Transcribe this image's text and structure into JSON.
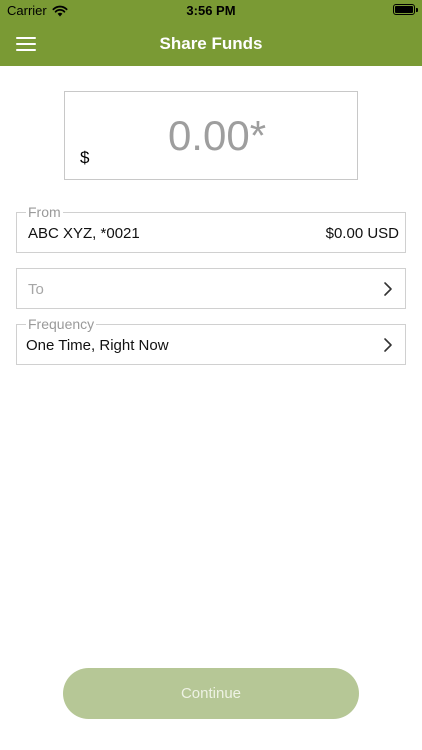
{
  "status_bar": {
    "carrier": "Carrier",
    "time": "3:56 PM"
  },
  "nav": {
    "title": "Share Funds",
    "menu_icon": "hamburger-menu-icon"
  },
  "amount": {
    "currency_symbol": "$",
    "value": "0.00*"
  },
  "from": {
    "label": "From",
    "account": "ABC XYZ, *0021",
    "balance": "$0.00 USD"
  },
  "to": {
    "placeholder": "To"
  },
  "frequency": {
    "label": "Frequency",
    "value": "One Time, Right Now"
  },
  "continue_button": {
    "label": "Continue"
  },
  "colors": {
    "brand": "#7a9a34",
    "button_disabled": "#b6c796"
  }
}
